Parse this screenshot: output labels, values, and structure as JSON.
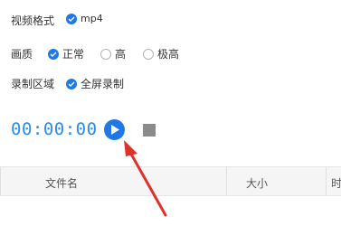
{
  "settings": {
    "format": {
      "label": "视频格式",
      "selected": "mp4"
    },
    "quality": {
      "label": "画质",
      "options": [
        {
          "label": "正常",
          "checked": true
        },
        {
          "label": "高",
          "checked": false
        },
        {
          "label": "极高",
          "checked": false
        }
      ]
    },
    "region": {
      "label": "录制区域",
      "selected": "全屏录制"
    }
  },
  "recorder": {
    "timer": "00:00:00"
  },
  "table": {
    "columns": [
      "文件名",
      "大小",
      "时"
    ]
  },
  "colors": {
    "accent": "#1f78e6",
    "timer": "#2d8ae8",
    "annotation_arrow": "#e0302a",
    "stop_button": "#8a8a8a"
  },
  "icons": {
    "play": "play-icon",
    "stop": "stop-icon",
    "check": "check-icon"
  }
}
